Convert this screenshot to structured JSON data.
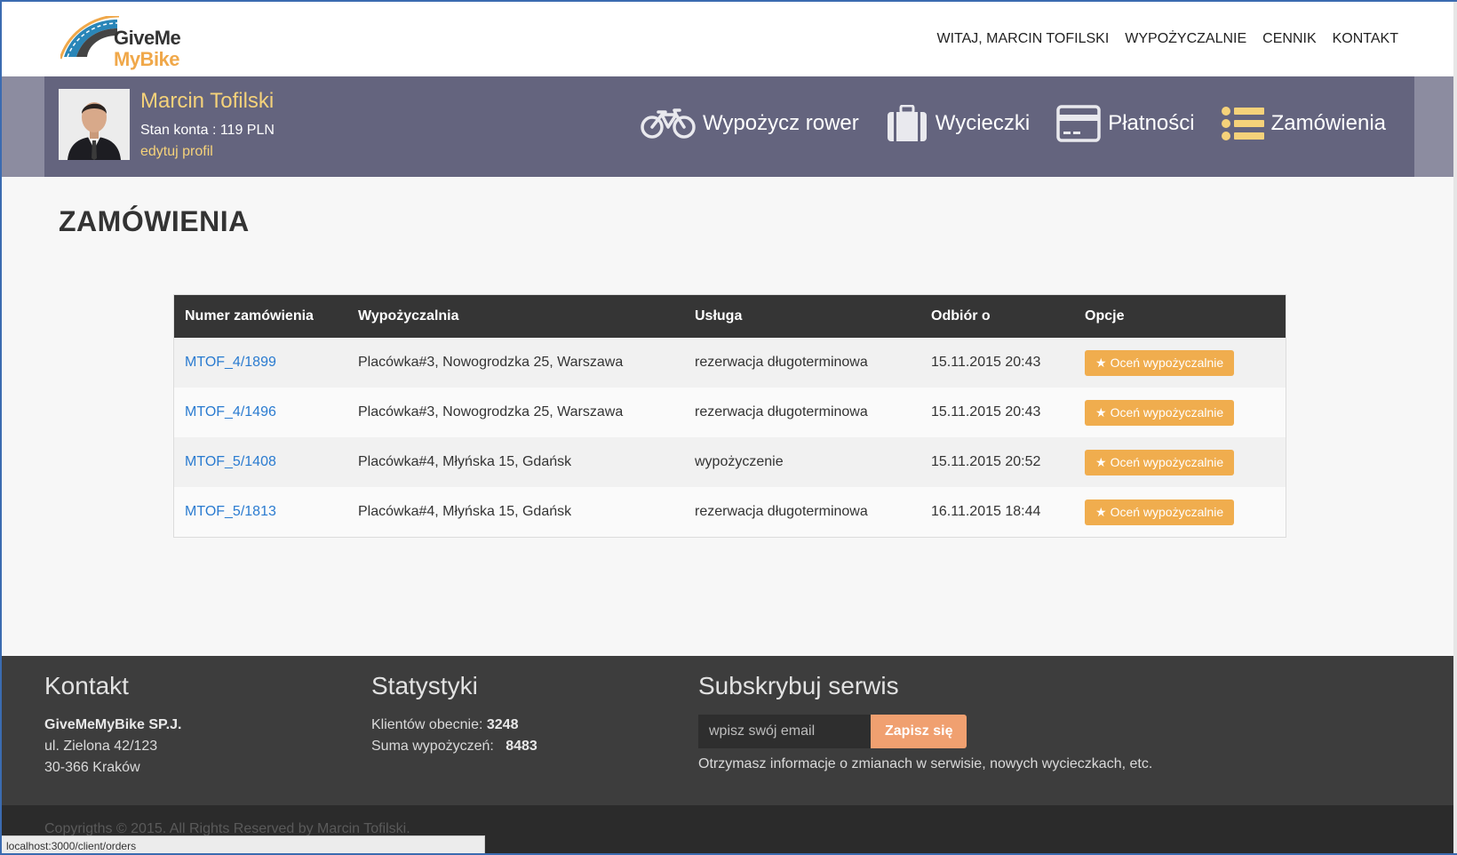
{
  "brand": {
    "line1": "GiveMe",
    "line2": "MyBike"
  },
  "topnav": [
    "WITAJ, MARCIN TOFILSKI",
    "WYPOŻYCZALNIE",
    "CENNIK",
    "KONTAKT"
  ],
  "profile": {
    "name": "Marcin Tofilski",
    "balance": "Stan konta : 119 PLN",
    "edit_label": "edytuj profil"
  },
  "bandnav": [
    {
      "label": "Wypożycz rower",
      "icon": "bicycle-icon"
    },
    {
      "label": "Wycieczki",
      "icon": "suitcase-icon"
    },
    {
      "label": "Płatności",
      "icon": "credit-card-icon"
    },
    {
      "label": "Zamówienia",
      "icon": "list-icon"
    }
  ],
  "page": {
    "title": "ZAMÓWIENIA"
  },
  "orders": {
    "columns": [
      "Numer zamówienia",
      "Wypożyczalnia",
      "Usługa",
      "Odbiór o",
      "Opcje"
    ],
    "rate_label": "Oceń wypożyczalnie",
    "rows": [
      {
        "id": "MTOF_4/1899",
        "place": "Placówka#3, Nowogrodzka 25, Warszawa",
        "service": "rezerwacja długoterminowa",
        "pickup": "15.11.2015 20:43"
      },
      {
        "id": "MTOF_4/1496",
        "place": "Placówka#3, Nowogrodzka 25, Warszawa",
        "service": "rezerwacja długoterminowa",
        "pickup": "15.11.2015 20:43"
      },
      {
        "id": "MTOF_5/1408",
        "place": "Placówka#4, Młyńska 15, Gdańsk",
        "service": "wypożyczenie",
        "pickup": "15.11.2015 20:52"
      },
      {
        "id": "MTOF_5/1813",
        "place": "Placówka#4, Młyńska 15, Gdańsk",
        "service": "rezerwacja długoterminowa",
        "pickup": "16.11.2015 18:44"
      }
    ]
  },
  "footer": {
    "contact": {
      "title": "Kontakt",
      "company": "GiveMeMyBike SP.J.",
      "street": "ul. Zielona 42/123",
      "city": "30-366 Kraków"
    },
    "stats": {
      "title": "Statystyki",
      "clients_label": "Klientów obecnie:",
      "clients_value": "3248",
      "rentals_label": "Suma wypożyczeń:",
      "rentals_value": "8483"
    },
    "subscribe": {
      "title": "Subskrybuj serwis",
      "placeholder": "wpisz swój email",
      "button": "Zapisz się",
      "note": "Otrzymasz informacje o zmianach w serwisie, nowych wycieczkach, etc."
    },
    "copyright": "Copyrigths © 2015. All Rights Reserved by Marcin Tofilski."
  },
  "statusbar": {
    "url": "localhost:3000/client/orders"
  },
  "colors": {
    "accent": "#f0ad4e",
    "band": "#64647e",
    "link": "#2a7bd0",
    "gold": "#f5d27a"
  }
}
